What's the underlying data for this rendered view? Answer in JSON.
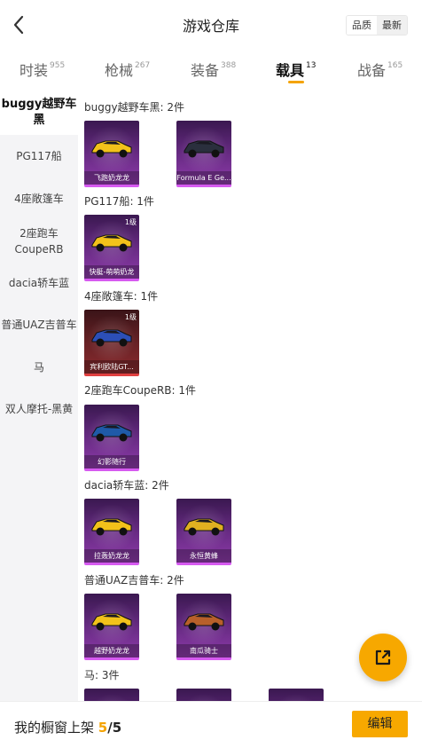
{
  "header": {
    "title": "游戏仓库",
    "sort_quality": "品质",
    "sort_newest": "最新"
  },
  "tabs": [
    {
      "label": "时装",
      "count": "955"
    },
    {
      "label": "枪械",
      "count": "267"
    },
    {
      "label": "装备",
      "count": "388"
    },
    {
      "label": "载具",
      "count": "13"
    },
    {
      "label": "战备",
      "count": "165"
    }
  ],
  "sidebar": {
    "items": [
      {
        "label": "buggy越野车黑"
      },
      {
        "label": "PG117船"
      },
      {
        "label": "4座敞篷车"
      },
      {
        "label": "2座跑车CoupeRB"
      },
      {
        "label": "dacia轿车蓝"
      },
      {
        "label": "普通UAZ吉普车"
      },
      {
        "label": "马"
      },
      {
        "label": "双人摩托-黑黄"
      }
    ]
  },
  "groups": [
    {
      "title": "buggy越野车黑: 2件",
      "cards": [
        {
          "label": "飞跑奶龙龙",
          "level": "",
          "icon": "buggy-icon",
          "car_color": "#f2c21a",
          "rarity": "purple"
        },
        {
          "label": "Formula E Ge...",
          "level": "",
          "icon": "formula-car-icon",
          "car_color": "#2a2f3d",
          "rarity": "purple"
        }
      ]
    },
    {
      "title": "PG117船: 1件",
      "cards": [
        {
          "label": "快艇-萌萌奶龙",
          "level": "1级",
          "icon": "boat-icon",
          "car_color": "#f2c21a",
          "rarity": "purple"
        }
      ]
    },
    {
      "title": "4座敞篷车: 1件",
      "cards": [
        {
          "label": "宾利欧陆GT...",
          "level": "1级",
          "icon": "convertible-icon",
          "car_color": "#2c4fb8",
          "rarity": "red"
        }
      ]
    },
    {
      "title": "2座跑车CoupeRB: 1件",
      "cards": [
        {
          "label": "幻影随行",
          "level": "",
          "icon": "sports-car-icon",
          "car_color": "#1f5aa8",
          "rarity": "purple"
        }
      ]
    },
    {
      "title": "dacia轿车蓝: 2件",
      "cards": [
        {
          "label": "拉轰奶龙龙",
          "level": "",
          "icon": "sedan-icon",
          "car_color": "#f2c21a",
          "rarity": "purple"
        },
        {
          "label": "永恒黄蜂",
          "level": "",
          "icon": "sedan-icon",
          "car_color": "#e0b020",
          "rarity": "purple"
        }
      ]
    },
    {
      "title": "普通UAZ吉普车: 2件",
      "cards": [
        {
          "label": "越野奶龙龙",
          "level": "",
          "icon": "jeep-icon",
          "car_color": "#f2c21a",
          "rarity": "purple"
        },
        {
          "label": "南瓜骑士",
          "level": "",
          "icon": "jeep-icon",
          "car_color": "#b8602a",
          "rarity": "purple"
        }
      ]
    },
    {
      "title": "马: 3件",
      "cards": [
        {
          "label": "",
          "level": "",
          "icon": "horse-icon",
          "car_color": "#c9a230",
          "rarity": "purple"
        },
        {
          "label": "",
          "level": "",
          "icon": "horse-icon",
          "car_color": "#c9a230",
          "rarity": "purple"
        },
        {
          "label": "",
          "level": "",
          "icon": "horse-icon",
          "car_color": "#c9a230",
          "rarity": "purple"
        }
      ]
    }
  ],
  "bottom": {
    "shelf_label": "我的橱窗上架 ",
    "shelf_count": "5",
    "shelf_total": "/5",
    "edit_label": "编辑"
  },
  "colors": {
    "accent": "#f7a800",
    "purple_rarity": "#d65af0",
    "red_rarity": "#e14040"
  }
}
